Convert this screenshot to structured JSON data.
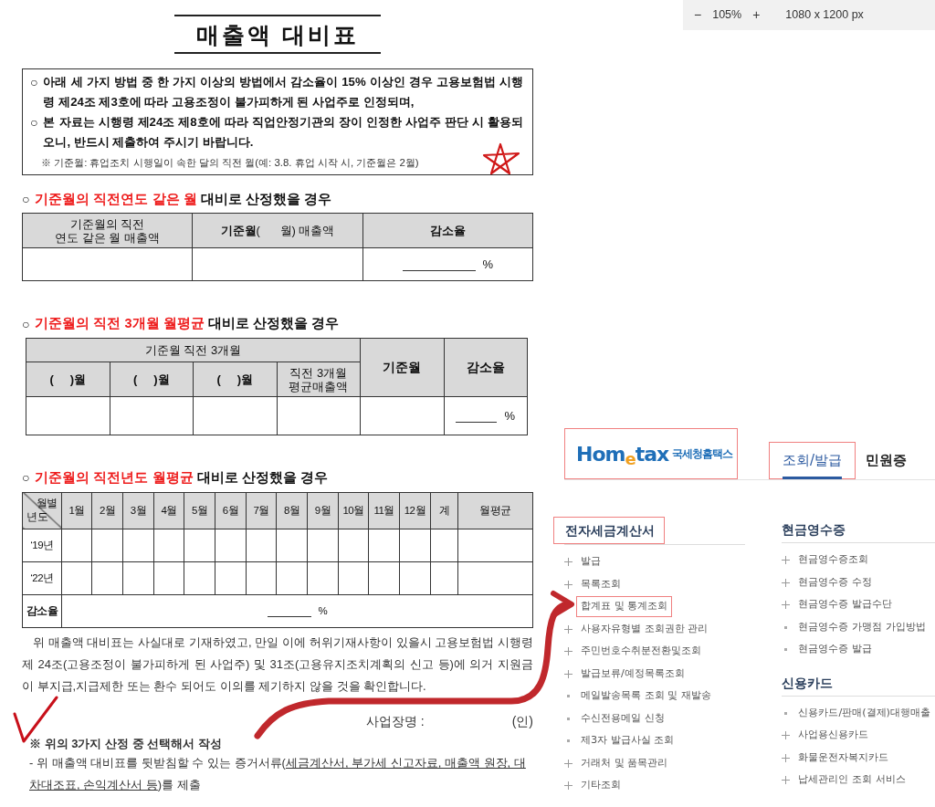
{
  "viewer": {
    "zoom_out": "−",
    "zoom": "105%",
    "zoom_in": "+",
    "size": "1080 x 1200 px"
  },
  "document": {
    "title": "매출액 대비표",
    "notice": [
      {
        "bullet": "○",
        "text": "아래 세 가지 방법 중 한 가지 이상의 방법에서 감소율이 15% 이상인 경우 고용보험법 시행령 제24조 제3호에 따라 고용조정이 불가피하게 된 사업주로 인정되며,"
      },
      {
        "bullet": "○",
        "text": "본 자료는 시행령 제24조 제8호에 따라 직업안정기관의 장이 인정한 사업주 판단 시 활용되오니, 반드시 제출하여 주시기 바랍니다."
      }
    ],
    "notice_note": "※ 기준월: 휴업조치 시행일이 속한 달의 직전 월(예: 3.8. 휴업 시작 시, 기준월은 2월)",
    "section1": {
      "bullet": "○",
      "highlight": "기준월의 직전연도 같은 월",
      "rest": "대비로 산정했을 경우",
      "headers": [
        "기준월의 직전\n연도 같은 월 매출액",
        "**기준월**(      월) 매출액",
        "감소율"
      ],
      "percent": "%"
    },
    "section2": {
      "bullet": "○",
      "highlight": "기준월의 직전 3개월 월평균",
      "rest": "대비로 산정했을 경우",
      "group_header": "기준월 직전 3개월",
      "sub_headers": [
        "(     )월",
        "(     )월",
        "(     )월",
        "직전 3개월\n평균매출액"
      ],
      "headers": [
        "기준월",
        "감소율"
      ],
      "percent": "%"
    },
    "section3": {
      "bullet": "○",
      "highlight": "기준월의 직전년도 월평균",
      "rest": "대비로 산정했을 경우",
      "corner_top": "월별",
      "corner_bottom": "년도",
      "columns": [
        "1월",
        "2월",
        "3월",
        "4월",
        "5월",
        "6월",
        "7월",
        "8월",
        "9월",
        "10월",
        "11월",
        "12월",
        "계",
        "월평균"
      ],
      "rows": [
        "‘19년",
        "‘22년"
      ],
      "total_label": "감소율",
      "percent": "%"
    },
    "pledge": "위 매출액 대비표는 사실대로 기재하였고, 만일 이에 허위기재사항이 있을시 고용보험법 시행령 제 24조(고용조정이 불가피하게 된 사업주) 및 31조(고용유지조치계획의 신고 등)에 의거 지원금이 부지급,지급제한 또는 환수 되어도 이의를 제기하지 않을 것을 확인합니다.",
    "signature": {
      "label": "사업장명 :",
      "seal": "(인)"
    },
    "footnote": "※ 위의 3가지 산정 중 선택해서 작성",
    "evidence": {
      "before": "- 위 매출액 대비표를 뒷받침할 수 있는 증거서류(",
      "underlined": "세금계산서, 부가세 신고자료, 매출액 원장, 대차대조표, 손익계산서 등",
      "after": ")를 제출"
    }
  },
  "hometax": {
    "logo": {
      "word": "Hom$_{e}$tax",
      "name": "국세청홈택스",
      "boxed": true
    },
    "tabs": [
      {
        "label": "조회/발급",
        "selected": true,
        "boxed": true
      },
      {
        "label": "민원증",
        "selected": false,
        "boxed": false
      }
    ],
    "left": {
      "heading": "전자세금계산서",
      "boxed": true,
      "items": [
        {
          "text": "발급",
          "kind": "plus",
          "boxed": false
        },
        {
          "text": "목록조회",
          "kind": "plus",
          "boxed": false
        },
        {
          "text": "합계표 및 통계조회",
          "kind": "plain",
          "boxed": true
        },
        {
          "text": "사용자유형별 조회권한 관리",
          "kind": "plus",
          "boxed": false
        },
        {
          "text": "주민번호수취분전환및조회",
          "kind": "plus",
          "boxed": false
        },
        {
          "text": "발급보류/예정목록조회",
          "kind": "plus",
          "boxed": false
        },
        {
          "text": "메일발송목록 조회 및 재발송",
          "kind": "dot",
          "boxed": false
        },
        {
          "text": "수신전용메일 신청",
          "kind": "dot",
          "boxed": false
        },
        {
          "text": "제3자 발급사실 조회",
          "kind": "dot",
          "boxed": false
        },
        {
          "text": "거래처 및 품목관리",
          "kind": "plus",
          "boxed": false
        },
        {
          "text": "기타조회",
          "kind": "plus",
          "boxed": false
        }
      ]
    },
    "right": [
      {
        "heading": "현금영수증",
        "items": [
          {
            "text": "현금영수증조회",
            "kind": "plus"
          },
          {
            "text": "현금영수증 수정",
            "kind": "plus"
          },
          {
            "text": "현금영수증 발급수단",
            "kind": "plus"
          },
          {
            "text": "현금영수증 가맹점 가입방법",
            "kind": "dot"
          },
          {
            "text": "현금영수증 발급",
            "kind": "dot"
          }
        ]
      },
      {
        "heading": "신용카드",
        "items": [
          {
            "text": "신용카드/판매(결제)대행매출",
            "kind": "dot"
          },
          {
            "text": "사업용신용카드",
            "kind": "plus"
          },
          {
            "text": "화물운전자복지카드",
            "kind": "plus"
          },
          {
            "text": "납세관리인 조회 서비스",
            "kind": "plus"
          }
        ]
      }
    ]
  }
}
